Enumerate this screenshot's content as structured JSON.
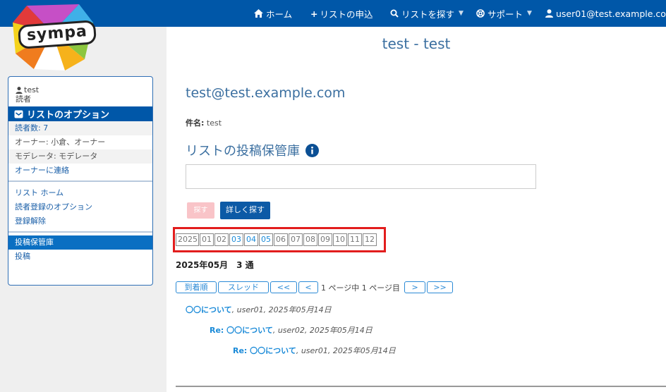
{
  "nav": {
    "home": "ホーム",
    "request_list": "リストの申込",
    "find_list": "リストを探す",
    "support": "サポート",
    "user": "user01@test.example.com"
  },
  "logo": {
    "text": "sympa"
  },
  "sidebar": {
    "user_name": "test",
    "user_role": "読者",
    "options_title": "リストのオプション",
    "info_rows": [
      "読者数: 7",
      "オーナー: 小倉、オーナー",
      "モデレータ: モデレータ",
      "オーナーに連絡"
    ],
    "menu": [
      "リスト ホーム",
      "読者登録のオプション",
      "登録解除"
    ],
    "archive_items": [
      "投稿保管庫",
      "投稿"
    ]
  },
  "main": {
    "page_title": "test - test",
    "list_address": "test@test.example.com",
    "subject_label": "件名:",
    "subject_value": "test",
    "archive_heading": "リストの投稿保管庫",
    "search_placeholder": "",
    "search_button": "探す",
    "advanced_button": "詳しく探す",
    "year": "2025",
    "months": [
      {
        "label": "01",
        "active": false
      },
      {
        "label": "02",
        "active": false
      },
      {
        "label": "03",
        "active": true
      },
      {
        "label": "04",
        "active": true
      },
      {
        "label": "05",
        "active": true
      },
      {
        "label": "06",
        "active": false
      },
      {
        "label": "07",
        "active": false
      },
      {
        "label": "08",
        "active": false
      },
      {
        "label": "09",
        "active": false
      },
      {
        "label": "10",
        "active": false
      },
      {
        "label": "11",
        "active": false
      },
      {
        "label": "12",
        "active": false
      }
    ],
    "count_text": "2025年05月　3 通",
    "pager": {
      "by_date": "到着順",
      "by_thread": "スレッド",
      "first": "<<",
      "prev": "<",
      "info": "1 ページ中 1 ページ目",
      "next": ">",
      "last": ">>"
    },
    "messages": [
      {
        "prefix": "",
        "subject": "〇〇について",
        "meta": ", user01, 2025年05月14日"
      },
      {
        "prefix": "Re: ",
        "subject": "〇〇について",
        "meta": ", user02, 2025年05月14日"
      },
      {
        "prefix": "Re: ",
        "subject": "〇〇について",
        "meta": ", user01, 2025年05月14日"
      }
    ]
  },
  "colors": {
    "nav": "#0057a8",
    "highlight": "#e21d1d",
    "link": "#1a8ad8"
  }
}
